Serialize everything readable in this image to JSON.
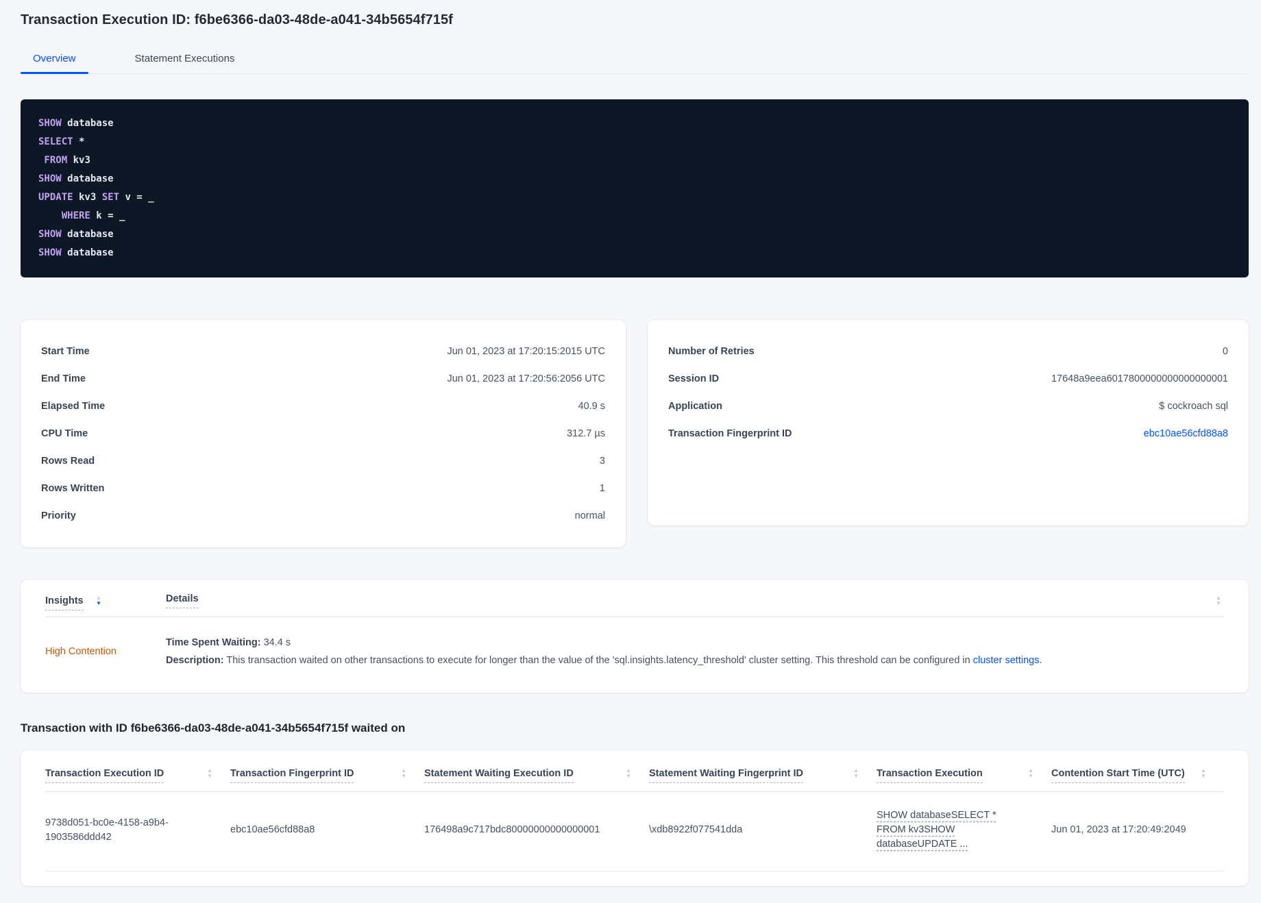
{
  "page": {
    "title": "Transaction Execution ID: f6be6366-da03-48de-a041-34b5654f715f"
  },
  "tabs": {
    "overview": "Overview",
    "statement_executions": "Statement Executions"
  },
  "code": {
    "lines": [
      {
        "parts": [
          {
            "t": "SHOW"
          },
          {
            "t": " database"
          }
        ]
      },
      {
        "parts": [
          {
            "t": "SELECT"
          },
          {
            "t": " *"
          }
        ]
      },
      {
        "parts": [
          {
            "t": " FROM"
          },
          {
            "t": " kv3"
          }
        ]
      },
      {
        "parts": [
          {
            "t": "SHOW"
          },
          {
            "t": " database"
          }
        ]
      },
      {
        "parts": [
          {
            "t": "UPDATE"
          },
          {
            "t": " kv3"
          },
          {
            "t": " SET"
          },
          {
            "t": " v = _"
          }
        ]
      },
      {
        "parts": [
          {
            "t": "    WHERE"
          },
          {
            "t": " k = _"
          }
        ]
      },
      {
        "parts": [
          {
            "t": "SHOW"
          },
          {
            "t": " database"
          }
        ]
      },
      {
        "parts": [
          {
            "t": "SHOW"
          },
          {
            "t": " database"
          }
        ]
      }
    ]
  },
  "summary_left": {
    "rows": [
      {
        "label": "Start Time",
        "value": "Jun 01, 2023 at 17:20:15:2015 UTC"
      },
      {
        "label": "End Time",
        "value": "Jun 01, 2023 at 17:20:56:2056 UTC"
      },
      {
        "label": "Elapsed Time",
        "value": "40.9 s"
      },
      {
        "label": "CPU Time",
        "value": "312.7 µs"
      },
      {
        "label": "Rows Read",
        "value": "3"
      },
      {
        "label": "Rows Written",
        "value": "1"
      },
      {
        "label": "Priority",
        "value": "normal"
      }
    ]
  },
  "summary_right": {
    "rows": [
      {
        "label": "Number of Retries",
        "value": "0"
      },
      {
        "label": "Session ID",
        "value": "17648a9eea6017800000000000000001"
      },
      {
        "label": "Application",
        "value": "$ cockroach sql"
      }
    ],
    "fingerprint_label": "Transaction Fingerprint ID",
    "fingerprint_value": "ebc10ae56cfd88a8"
  },
  "insights_table": {
    "header_insights": "Insights",
    "header_details": "Details",
    "row": {
      "insight": "High Contention",
      "waiting_label": "Time Spent Waiting:",
      "waiting_value": " 34.4 s",
      "description_label": "Description:",
      "description_text": " This transaction waited on other transactions to execute for longer than the value of the 'sql.insights.latency_threshold' cluster setting. This threshold can be configured in ",
      "description_link": "cluster settings",
      "description_suffix": "."
    }
  },
  "waited_on": {
    "heading": "Transaction with ID f6be6366-da03-48de-a041-34b5654f715f waited on",
    "headers": [
      "Transaction Execution ID",
      "Transaction Fingerprint ID",
      "Statement Waiting Execution ID",
      "Statement Waiting Fingerprint ID",
      "Transaction Execution",
      "Contention Start Time (UTC)"
    ],
    "row": {
      "transaction_execution_id": "9738d051-bc0e-4158-a9b4-1903586ddd42",
      "transaction_fingerprint_id": "ebc10ae56cfd88a8",
      "statement_waiting_execution_id": "176498a9c717bdc80000000000000001",
      "statement_waiting_fingerprint_id": "\\xdb8922f077541dda",
      "transaction_execution": "SHOW databaseSELECT * FROM kv3SHOW databaseUPDATE ...",
      "contention_start_time": "Jun 01, 2023 at 17:20:49:2049"
    }
  },
  "colors": {
    "accent_blue": "#0055ff",
    "warning_orange": "#bd5c0d",
    "code_background": "#0e1726",
    "code_keyword": "#c0a3ef",
    "code_identifier": "#e3e7f0"
  }
}
